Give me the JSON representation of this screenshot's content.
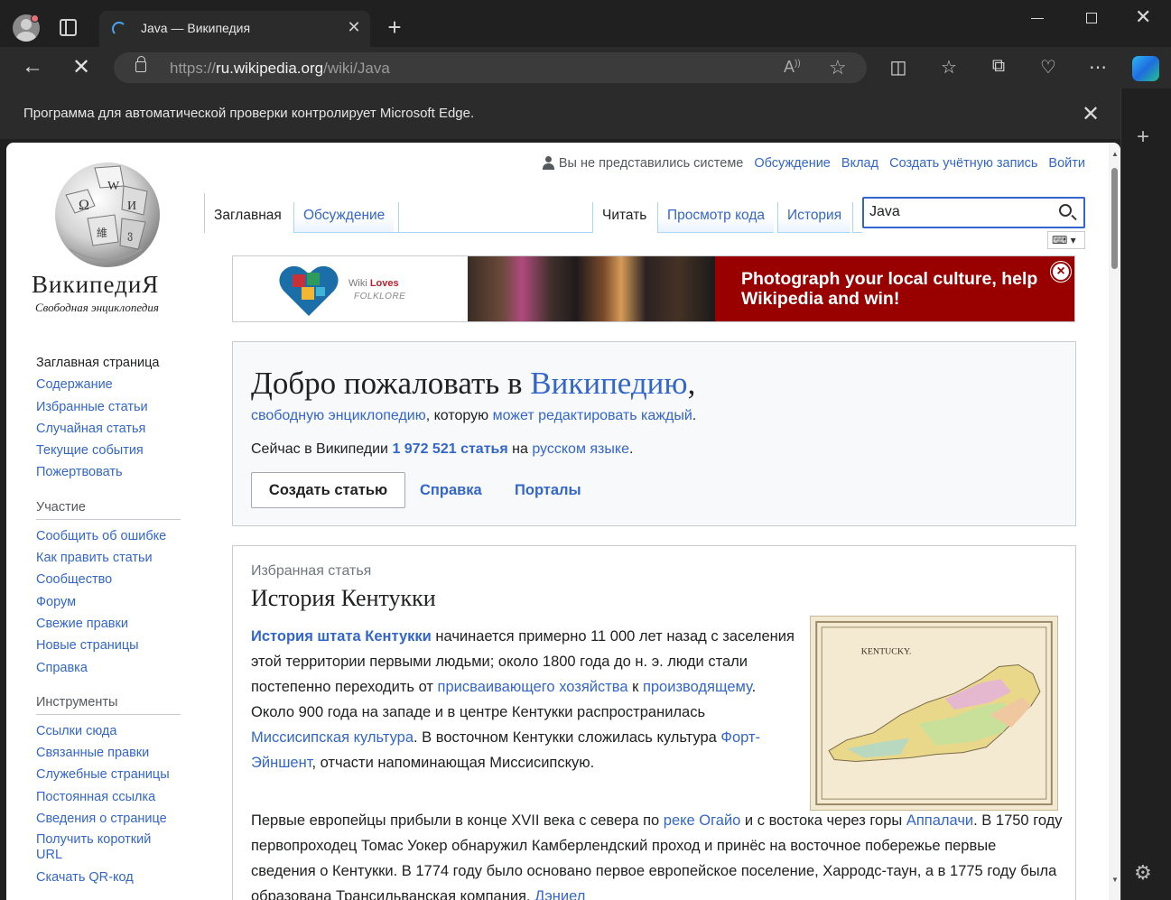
{
  "browser": {
    "tab_title": "Java — Википедия",
    "url_prefix": "https://",
    "url_host": "ru.wikipedia.org",
    "url_path": "/wiki/Java",
    "infobar_text": "Программа для автоматической проверки контролирует Microsoft Edge."
  },
  "logo": {
    "title": "ВикипедиЯ",
    "tagline": "Свободная энциклопедия"
  },
  "personal": {
    "not_logged": "Вы не представились системе",
    "links": [
      "Обсуждение",
      "Вклад",
      "Создать учётную запись",
      "Войти"
    ]
  },
  "tabs": {
    "main": "Заглавная",
    "discussion": "Обсуждение",
    "read": "Читать",
    "view_source": "Просмотр кода",
    "history": "История"
  },
  "search": {
    "value": "Java"
  },
  "nav": {
    "main": [
      "Заглавная страница",
      "Содержание",
      "Избранные статьи",
      "Случайная статья",
      "Текущие события",
      "Пожертвовать"
    ],
    "participation_heading": "Участие",
    "participation": [
      "Сообщить об ошибке",
      "Как править статьи",
      "Сообщество",
      "Форум",
      "Свежие правки",
      "Новые страницы",
      "Справка"
    ],
    "tools_heading": "Инструменты",
    "tools": [
      "Ссылки сюда",
      "Связанные правки",
      "Служебные страницы",
      "Постоянная ссылка",
      "Сведения о странице",
      "Получить короткий URL",
      "Скачать QR-код"
    ]
  },
  "banner": {
    "wlf_a": "Wiki ",
    "wlf_b": "Loves",
    "wlf_sub": "FOLKLORE",
    "message": "Photograph your local culture, help Wikipedia and win!"
  },
  "welcome": {
    "title_pre": "Добро пожаловать в ",
    "title_link": "Википедию",
    "title_post": ",",
    "sub_link1": "свободную энциклопедию",
    "sub_mid": ", которую ",
    "sub_link2": "может редактировать каждый",
    "sub_end": ".",
    "count_pre": "Сейчас в Википедии ",
    "count_link": "1 972 521 статья",
    "count_mid": " на ",
    "count_lang": "русском языке",
    "count_end": ".",
    "create": "Создать статью",
    "help": "Справка",
    "portals": "Порталы"
  },
  "featured": {
    "label": "Избранная статья",
    "title": "История Кентукки",
    "p1_link": "История штата Кентукки",
    "p1_a": " начинается примерно 11 000 лет назад с заселения этой территории первыми людьми; около 1800 года до н. э. люди стали постепенно переходить от ",
    "p1_l2": "присваивающего хозяйства",
    "p1_b": " к ",
    "p1_l3": "производящему",
    "p1_c": ". Около 900 года на западе и в центре Кентукки распространилась ",
    "p1_l4": "Миссисипская культура",
    "p1_d": ". В восточном Кентукки сложилась культура ",
    "p1_l5": "Форт-Эйншент",
    "p1_e": ", отчасти напоминающая Миссисипскую.",
    "p2_a": "Первые европейцы прибыли в конце XVII века с севера по ",
    "p2_l1": "реке Огайо",
    "p2_b": " и с востока через горы ",
    "p2_l2": "Аппалачи",
    "p2_c": ". В 1750 году первопроходец Томас Уокер обнаружил Камберлендский проход и принёс на восточное побережье первые сведения о Кентукки. В 1774 году было основано первое европейское поселение, Харродс-таун, а в 1775 году была образована Трансильванская компания. ",
    "p2_l3": "Дэниел",
    "map_label": "KENTUCKY."
  }
}
